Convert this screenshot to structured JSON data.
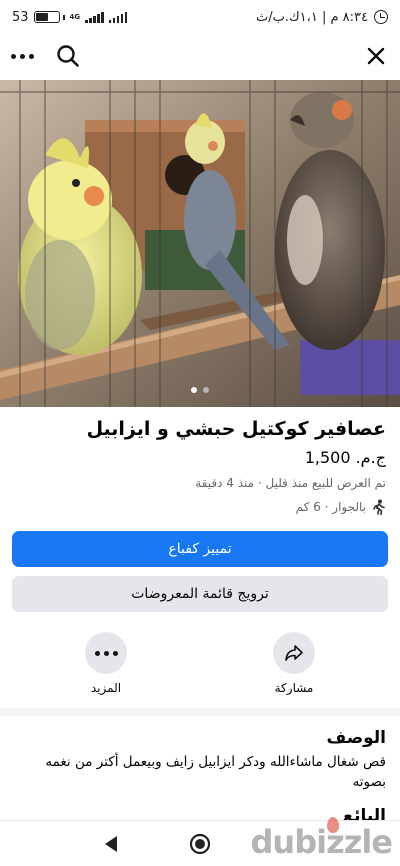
{
  "status_bar": {
    "battery_level": "53",
    "battery_fraction": 0.53,
    "network_type": "4G",
    "clock": "٨:٣٤ م | ١،١ك.ب/ث",
    "alarm_icon": "alarm-icon"
  },
  "top_bar": {
    "close_icon": "close-icon",
    "search_icon": "search-icon",
    "more_icon": "more-icon"
  },
  "photo": {
    "description_icon": "product-photo",
    "slide_count": 2,
    "active_slide": 1
  },
  "listing": {
    "title": "عصافير كوكتيل حبشي و ايزابيل",
    "price": "ج.م. 1,500",
    "meta": "تم العرض للبيع منذ قليل · منذ 4 دقيقة",
    "location": "بالجوار · 6 كم"
  },
  "buttons": {
    "boost": "تمييز كفباع",
    "promote": "ترويج قائمة المعروضات"
  },
  "actions": {
    "share": "مشاركة",
    "more": "المزيد"
  },
  "description": {
    "heading": "الوصف",
    "text": "قص شغال ماشاءالله ودكر ايزابيل زايف وبيعمل أكتر من نغمه بصوته",
    "next_heading": "البائع"
  },
  "watermark": "dubizzle",
  "colors": {
    "primary": "#1877f2",
    "secondary_bg": "#e4e6eb",
    "muted_text": "#65676b"
  }
}
